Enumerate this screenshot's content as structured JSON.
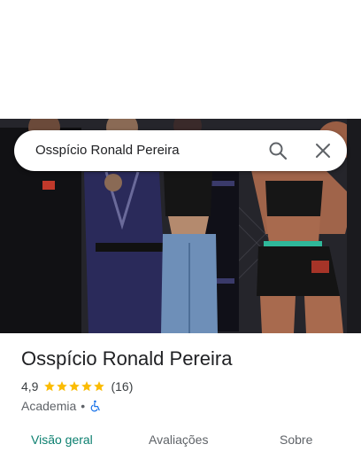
{
  "search": {
    "query": "Osspício Ronald Pereira"
  },
  "place": {
    "name": "Osspício Ronald Pereira",
    "rating": "4,9",
    "stars": 5,
    "reviews_count": "(16)",
    "category": "Academia",
    "separator": "•"
  },
  "tabs": [
    {
      "label": "Visão geral",
      "active": true
    },
    {
      "label": "Avaliações",
      "active": false
    },
    {
      "label": "Sobre",
      "active": false
    }
  ],
  "colors": {
    "accent": "#0b7f6f",
    "star": "#fbbc04",
    "accessibility": "#1a73e8"
  },
  "icons": [
    "search-icon",
    "close-icon",
    "star-icon",
    "accessible-icon"
  ]
}
